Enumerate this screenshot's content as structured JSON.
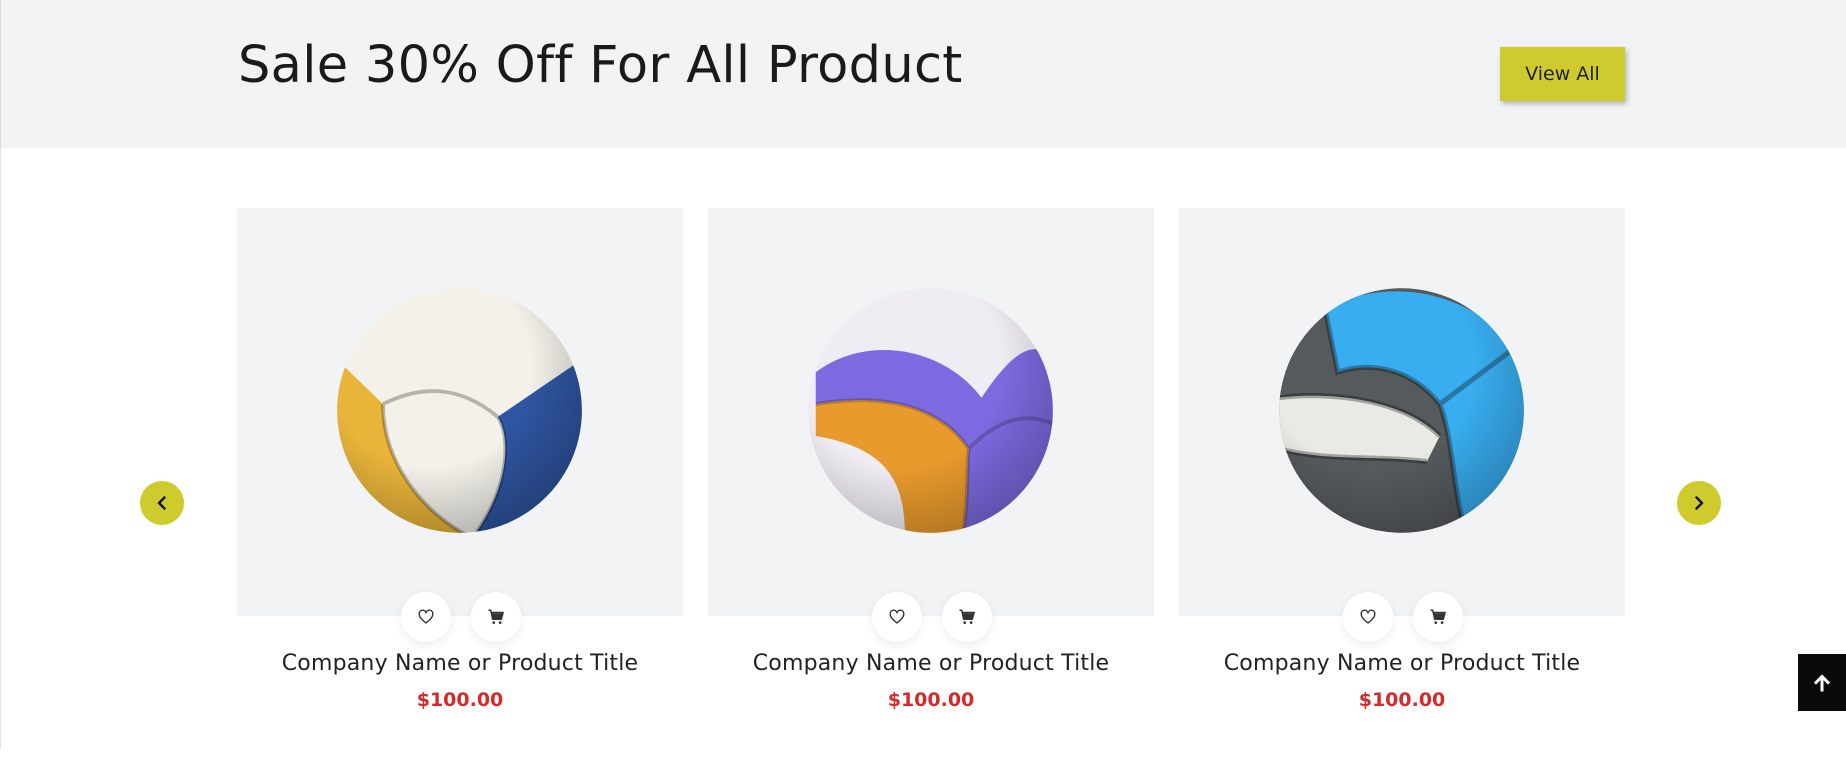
{
  "banner": {
    "title": "Sale 30% Off For All Product",
    "view_all_label": "View All"
  },
  "carousel": {
    "prev_icon": "chevron-left-icon",
    "next_icon": "chevron-right-icon",
    "products": [
      {
        "title": "Company Name or Product Title",
        "price": "$100.00",
        "ball_colors": [
          "#e8b43a",
          "#2f56a3",
          "#f3f1ea"
        ]
      },
      {
        "title": "Company Name or Product Title",
        "price": "$100.00",
        "ball_colors": [
          "#e89a2c",
          "#7d6ae0",
          "#f0ecf4"
        ]
      },
      {
        "title": "Company Name or Product Title",
        "price": "$100.00",
        "ball_colors": [
          "#38aef0",
          "#555a5c",
          "#e9eae6"
        ]
      }
    ]
  },
  "scroll_top": {
    "icon": "arrow-up-icon"
  },
  "colors": {
    "accent": "#cfcb2e",
    "price": "#d32a2a",
    "banner_bg": "#f2f3f5",
    "card_bg": "#f2f3f5"
  }
}
